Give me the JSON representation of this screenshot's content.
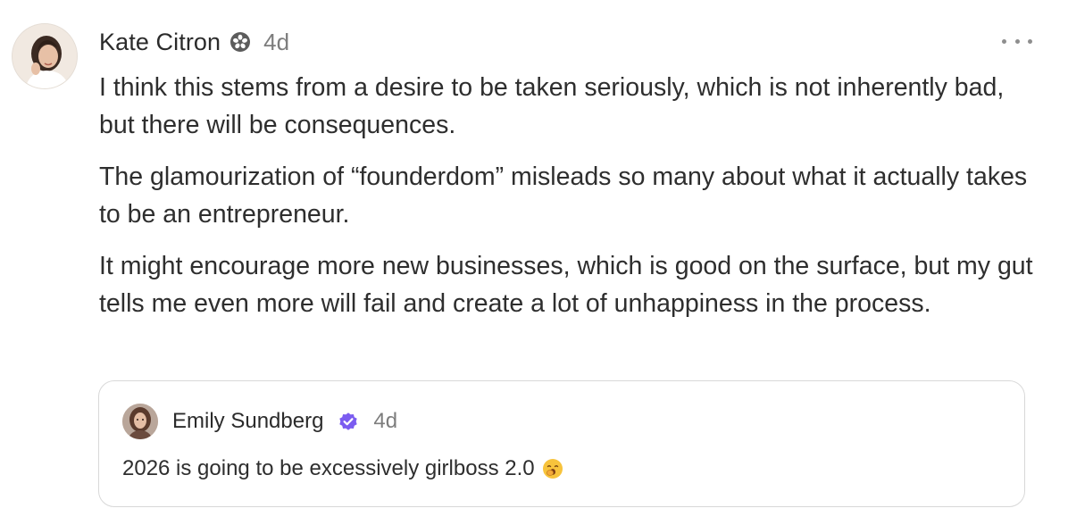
{
  "post": {
    "author": {
      "name": "Kate Citron",
      "badge_icon": "flower-badge-icon",
      "avatar_icon": "profile-photo"
    },
    "timestamp": "4d",
    "more_icon": "ellipsis-icon",
    "paragraphs": [
      "I think this stems from a desire to be taken seriously, which is not inherently bad, but there will be consequences.",
      "The glamourization of “founderdom” misleads so many about what it actually takes to be an entrepreneur.",
      "It might encourage more new businesses, which is good on the surface, but my gut tells me even more will fail and create a lot of unhappiness in the process."
    ]
  },
  "quoted_post": {
    "author": {
      "name": "Emily Sundberg",
      "badge_icon": "verified-check-icon",
      "badge_color": "#7b5cf0",
      "avatar_icon": "profile-photo"
    },
    "timestamp": "4d",
    "text": "2026 is going to be excessively girlboss 2.0",
    "emoji_icon": "yawning-face-emoji"
  }
}
